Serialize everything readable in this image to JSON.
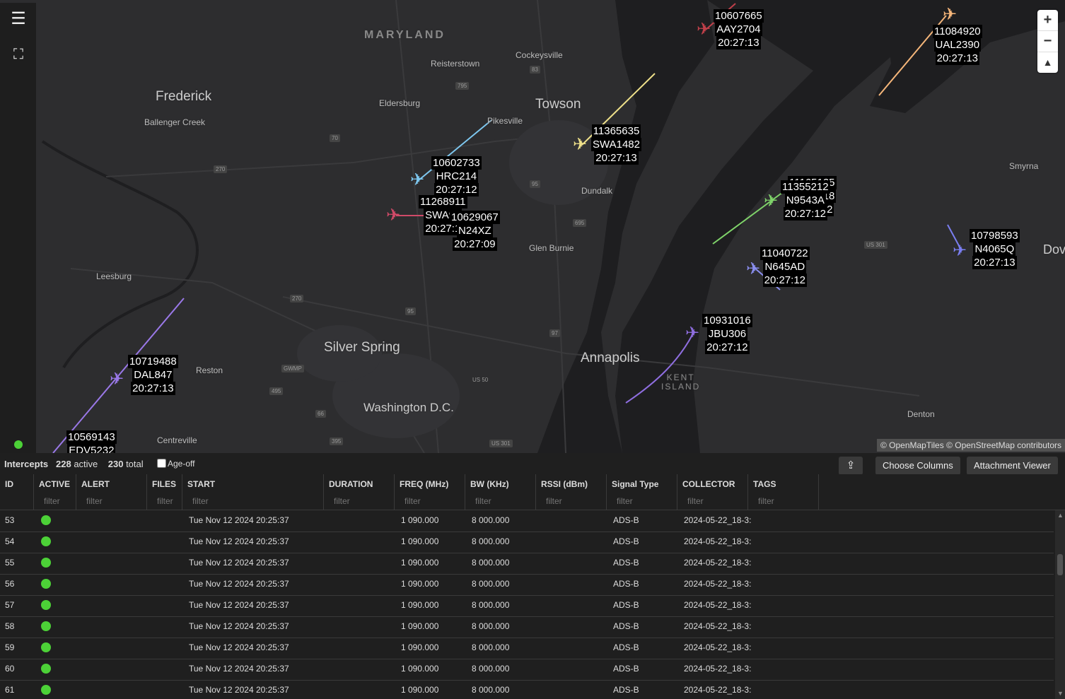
{
  "map": {
    "places": {
      "maryland": "MARYLAND",
      "frederick": "Frederick",
      "ballenger_creek": "Ballenger Creek",
      "reisterstown": "Reisterstown",
      "cockeysville": "Cockeysville",
      "eldersburg": "Eldersburg",
      "pikesville": "Pikesville",
      "towson": "Towson",
      "dundalk": "Dundalk",
      "glen_burnie": "Glen Burnie",
      "leesburg": "Leesburg",
      "reston": "Reston",
      "silver_spring": "Silver Spring",
      "washington": "Washington D.C.",
      "annapolis": "Annapolis",
      "kent_island": "KENT\nISLAND",
      "centreville": "Centreville",
      "denton": "Denton",
      "smyrna": "Smyrna",
      "dover": "Dov"
    },
    "routes": [
      "795",
      "83",
      "70",
      "270",
      "95",
      "695",
      "270",
      "95",
      "97",
      "GWMP",
      "495",
      "66",
      "395",
      "US 50",
      "US 301",
      "US 301"
    ],
    "aircraft": [
      {
        "id": "10607665",
        "callsign": "AAY2704",
        "time": "20:27:13",
        "color": "#c0404a"
      },
      {
        "id": "11084920",
        "callsign": "UAL2390",
        "time": "20:27:13",
        "color": "#f5b67a"
      },
      {
        "id": "11365635",
        "callsign": "SWA1482",
        "time": "20:27:13",
        "color": "#eee08a"
      },
      {
        "id": "10602733",
        "callsign": "HRC214",
        "time": "20:27:12",
        "color": "#7ec8f0"
      },
      {
        "id": "11268911",
        "callsign": "SWA91",
        "time": "20:27:1",
        "color": "#d04a68"
      },
      {
        "id": "10629067",
        "callsign": "N24XZ",
        "time": "20:27:09",
        "color": "#d04a68"
      },
      {
        "id": "11165125",
        "callsign": "PDA3518",
        "time": "20:27:12",
        "color": "#7fd36a"
      },
      {
        "id": "11355212",
        "callsign": "N9543A",
        "time": "20:27:12",
        "color": "#7fd36a"
      },
      {
        "id": "10798593",
        "callsign": "N4065Q",
        "time": "20:27:13",
        "color": "#7a7ef0"
      },
      {
        "id": "11040722",
        "callsign": "N645AD",
        "time": "20:27:12",
        "color": "#8a8ef0"
      },
      {
        "id": "10931016",
        "callsign": "JBU306",
        "time": "20:27:12",
        "color": "#8f6ee0"
      },
      {
        "id": "10719488",
        "callsign": "DAL847",
        "time": "20:27:13",
        "color": "#9a78e8"
      },
      {
        "id": "10569143",
        "callsign": "EDV5232",
        "time": "",
        "color": "#8ab4f8"
      }
    ],
    "attribution": "© OpenMapTiles © OpenStreetMap contributors",
    "zoom_in": "+",
    "zoom_out": "−",
    "reset_north": "▲"
  },
  "sidebar": {
    "menu_icon": "☰",
    "fullscreen_icon": "⛶"
  },
  "panel": {
    "title": "Intercepts",
    "active_count": "228",
    "active_label": "active",
    "total_count": "230",
    "total_label": "total",
    "ageoff_label": "Age-off",
    "export_icon": "⇪",
    "choose_columns": "Choose Columns",
    "attachment_viewer": "Attachment Viewer",
    "filter_placeholder": "filter",
    "columns": [
      "ID",
      "ACTIVE",
      "ALERT",
      "FILES",
      "START",
      "DURATION",
      "FREQ (MHz)",
      "BW (KHz)",
      "RSSI (dBm)",
      "Signal Type",
      "COLLECTOR",
      "TAGS"
    ],
    "rows": [
      {
        "id": "53",
        "start": "Tue Nov 12 2024 20:25:37",
        "freq": "1 090.000",
        "bw": "8 000.000",
        "signal": "ADS-B",
        "collector": "2024-05-22_18-3:"
      },
      {
        "id": "54",
        "start": "Tue Nov 12 2024 20:25:37",
        "freq": "1 090.000",
        "bw": "8 000.000",
        "signal": "ADS-B",
        "collector": "2024-05-22_18-3:"
      },
      {
        "id": "55",
        "start": "Tue Nov 12 2024 20:25:37",
        "freq": "1 090.000",
        "bw": "8 000.000",
        "signal": "ADS-B",
        "collector": "2024-05-22_18-3:"
      },
      {
        "id": "56",
        "start": "Tue Nov 12 2024 20:25:37",
        "freq": "1 090.000",
        "bw": "8 000.000",
        "signal": "ADS-B",
        "collector": "2024-05-22_18-3:"
      },
      {
        "id": "57",
        "start": "Tue Nov 12 2024 20:25:37",
        "freq": "1 090.000",
        "bw": "8 000.000",
        "signal": "ADS-B",
        "collector": "2024-05-22_18-3:"
      },
      {
        "id": "58",
        "start": "Tue Nov 12 2024 20:25:37",
        "freq": "1 090.000",
        "bw": "8 000.000",
        "signal": "ADS-B",
        "collector": "2024-05-22_18-3:"
      },
      {
        "id": "59",
        "start": "Tue Nov 12 2024 20:25:37",
        "freq": "1 090.000",
        "bw": "8 000.000",
        "signal": "ADS-B",
        "collector": "2024-05-22_18-3:"
      },
      {
        "id": "60",
        "start": "Tue Nov 12 2024 20:25:37",
        "freq": "1 090.000",
        "bw": "8 000.000",
        "signal": "ADS-B",
        "collector": "2024-05-22_18-3:"
      },
      {
        "id": "61",
        "start": "Tue Nov 12 2024 20:25:37",
        "freq": "1 090.000",
        "bw": "8 000.000",
        "signal": "ADS-B",
        "collector": "2024-05-22_18-3:"
      }
    ]
  }
}
